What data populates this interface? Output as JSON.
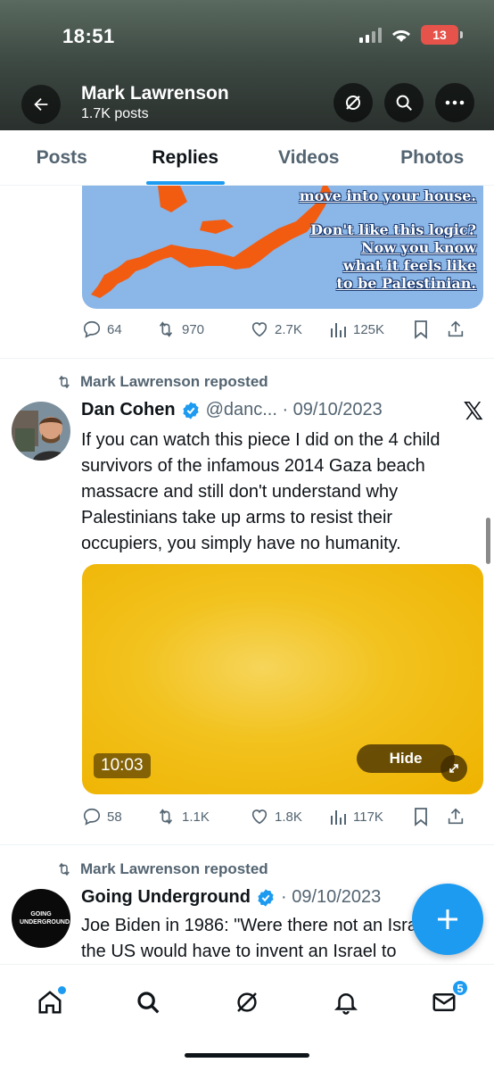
{
  "status_bar": {
    "time": "18:51",
    "battery": "13"
  },
  "header": {
    "name": "Mark Lawrenson",
    "posts": "1.7K posts"
  },
  "tabs": [
    {
      "label": "Posts"
    },
    {
      "label": "Replies"
    },
    {
      "label": "Videos"
    },
    {
      "label": "Photos"
    }
  ],
  "tweet1": {
    "image_caption": [
      "move into your house.",
      "Don't like this logic?",
      "Now you know",
      "what it feels like",
      "to be Palestinian."
    ],
    "stats": {
      "replies": "64",
      "reposts": "970",
      "likes": "2.7K",
      "views": "125K"
    }
  },
  "tweet2": {
    "repost_label": "Mark Lawrenson reposted",
    "name": "Dan Cohen",
    "meta": "@danc... · 09/10/2023",
    "text": "If you can watch this piece I did on the 4 child survivors of the infamous 2014 Gaza beach massacre and still don't understand why Palestinians take up arms to resist their occupiers, you simply have no humanity.",
    "video_duration": "10:03",
    "hide_label": "Hide",
    "stats": {
      "replies": "58",
      "reposts": "1.1K",
      "likes": "1.8K",
      "views": "117K"
    }
  },
  "tweet3": {
    "repost_label": "Mark Lawrenson reposted",
    "name": "Going Underground",
    "meta": "· 09/10/2023",
    "avatar_text": "GOING UNDERGROUND",
    "text": "Joe Biden in 1986: \"Were there not an Israel the US would have to invent an Israel to"
  },
  "bottom_nav": {
    "messages_badge": "5"
  }
}
